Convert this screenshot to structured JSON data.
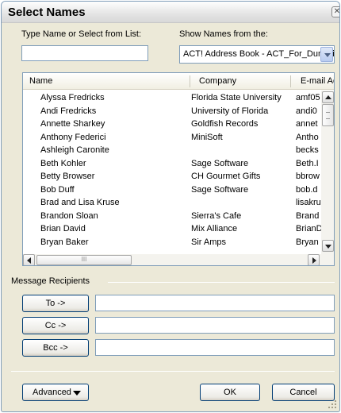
{
  "window": {
    "title": "Select Names",
    "close_glyph": "✕"
  },
  "search": {
    "label": "Type Name or Select from List:",
    "value": ""
  },
  "show_names": {
    "label": "Show Names from the:",
    "selected": "ACT! Address Book - ACT_For_Dummies"
  },
  "columns": [
    "Name",
    "Company",
    "E-mail Address"
  ],
  "contacts": [
    {
      "name": "Alyssa Fredricks",
      "company": "Florida State University",
      "email": "amf05"
    },
    {
      "name": "Andi Fredricks",
      "company": "University of Florida",
      "email": "andi0"
    },
    {
      "name": "Annette Sharkey",
      "company": "Goldfish Records",
      "email": "annet"
    },
    {
      "name": "Anthony Federici",
      "company": "MiniSoft",
      "email": "Antho"
    },
    {
      "name": "Ashleigh Caronite",
      "company": "",
      "email": "becks"
    },
    {
      "name": "Beth Kohler",
      "company": "Sage Software",
      "email": "Beth.I"
    },
    {
      "name": "Betty Browser",
      "company": "CH Gourmet Gifts",
      "email": "bbrow"
    },
    {
      "name": "Bob Duff",
      "company": "Sage Software",
      "email": "bob.d"
    },
    {
      "name": "Brad and Lisa Kruse",
      "company": "",
      "email": "lisakru"
    },
    {
      "name": "Brandon Sloan",
      "company": "Sierra's Cafe",
      "email": "Brand"
    },
    {
      "name": "Brian David",
      "company": "Mix Alliance",
      "email": "BrianD"
    },
    {
      "name": "Bryan Baker",
      "company": "Sir Amps",
      "email": "Bryan"
    }
  ],
  "hscroll_thumb_glyph": "III",
  "recipients": {
    "label": "Message Recipients",
    "to_label": "To ->",
    "to_value": "",
    "cc_label": "Cc ->",
    "cc_value": "",
    "bcc_label": "Bcc ->",
    "bcc_value": ""
  },
  "buttons": {
    "advanced": "Advanced",
    "ok": "OK",
    "cancel": "Cancel"
  }
}
